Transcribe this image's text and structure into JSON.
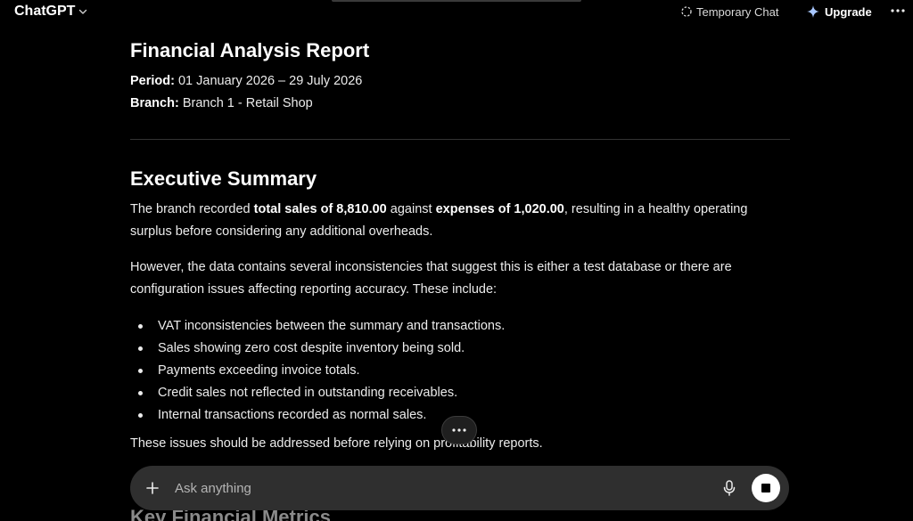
{
  "header": {
    "model_name": "ChatGPT",
    "temporary_chat_label": "Temporary Chat",
    "upgrade_label": "Upgrade"
  },
  "report": {
    "title": "Financial Analysis Report",
    "period_label": "Period:",
    "period_value": "01 January 2026 – 29 July 2026",
    "branch_label": "Branch:",
    "branch_value": "Branch 1 - Retail Shop",
    "executive_summary": {
      "heading": "Executive Summary",
      "p1_a": "The branch recorded ",
      "p1_b": "total sales of 8,810.00",
      "p1_c": " against ",
      "p1_d": "expenses of 1,020.00",
      "p1_e": ", resulting in a healthy operating surplus before considering any additional overheads.",
      "p2": "However, the data contains several inconsistencies that suggest this is either a test database or there are configuration issues affecting reporting accuracy. These include:",
      "issues": [
        "VAT inconsistencies between the summary and transactions.",
        "Sales showing zero cost despite inventory being sold.",
        "Payments exceeding invoice totals.",
        "Credit sales not reflected in outstanding receivables.",
        "Internal transactions recorded as normal sales."
      ],
      "p3": "These issues should be addressed before relying on profitability reports."
    },
    "next_heading": "Key Financial Metrics"
  },
  "composer": {
    "placeholder": "Ask anything"
  },
  "icons": {
    "chevron": "chevron-down-icon",
    "temporary_chat": "dashed-circle-icon",
    "upgrade": "sparkle-icon",
    "more": "more-horizontal-icon",
    "plus": "plus-icon",
    "mic": "microphone-icon",
    "stop": "stop-icon"
  }
}
